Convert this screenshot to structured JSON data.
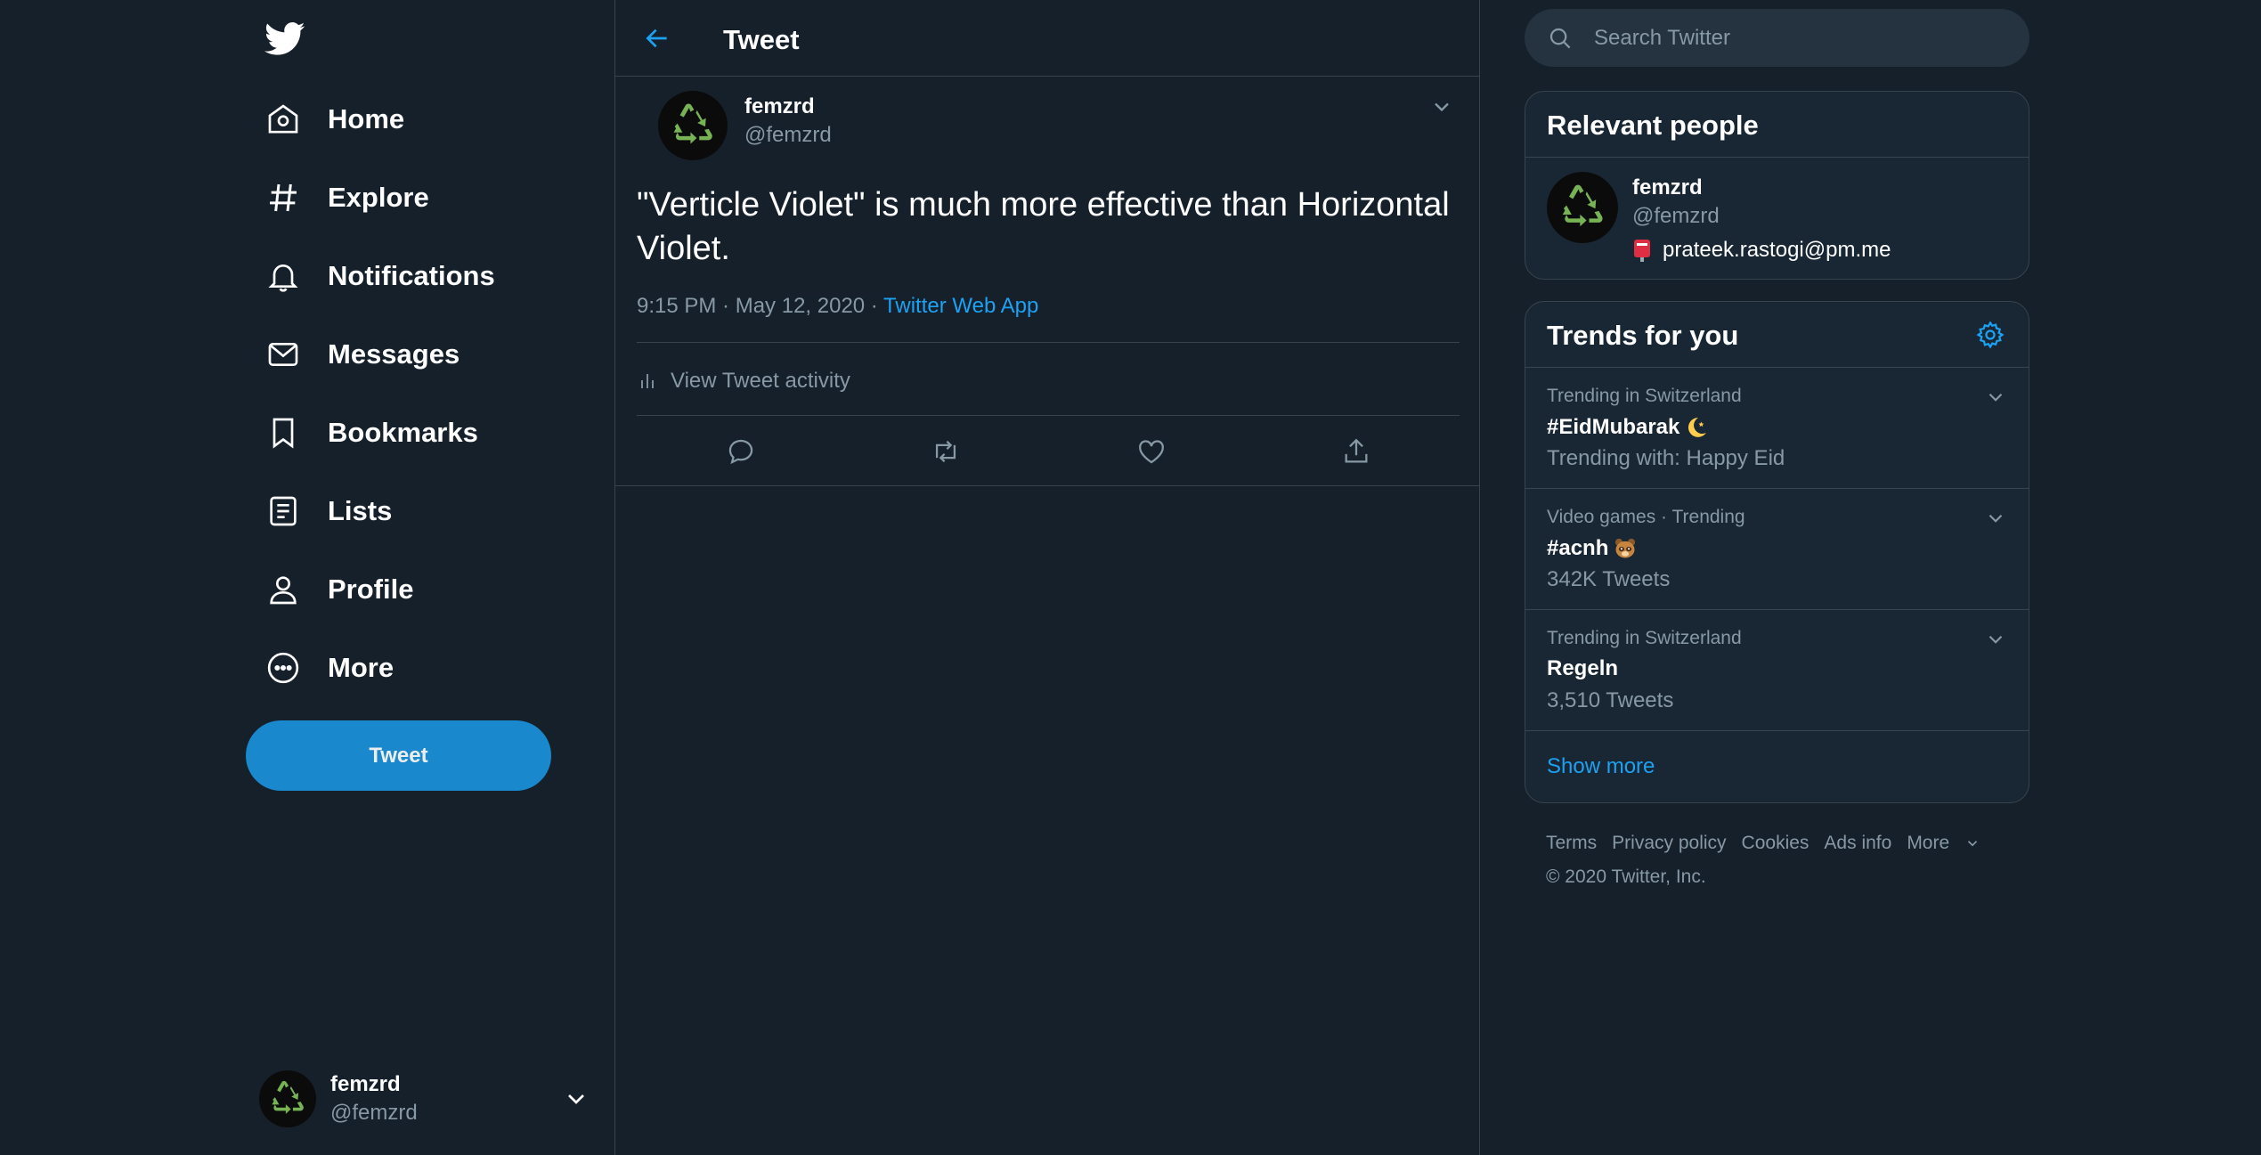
{
  "sidebar": {
    "logo": "twitter-bird-icon",
    "nav": [
      {
        "label": "Home",
        "icon": "home-icon"
      },
      {
        "label": "Explore",
        "icon": "hashtag-icon"
      },
      {
        "label": "Notifications",
        "icon": "bell-icon"
      },
      {
        "label": "Messages",
        "icon": "envelope-icon"
      },
      {
        "label": "Bookmarks",
        "icon": "bookmark-icon"
      },
      {
        "label": "Lists",
        "icon": "list-icon"
      },
      {
        "label": "Profile",
        "icon": "person-icon"
      },
      {
        "label": "More",
        "icon": "more-circle-icon"
      }
    ],
    "tweet_button": "Tweet",
    "account": {
      "name": "femzrd",
      "handle": "@femzrd"
    }
  },
  "main": {
    "header_title": "Tweet",
    "tweet": {
      "author_name": "femzrd",
      "author_handle": "@femzrd",
      "text": "\"Verticle Violet\" is much more effective than Horizontal Violet.",
      "time": "9:15 PM · May 12, 2020 · ",
      "source": "Twitter Web App",
      "activity_label": "View Tweet activity"
    }
  },
  "right": {
    "search_placeholder": "Search Twitter",
    "relevant": {
      "title": "Relevant people",
      "person": {
        "name": "femzrd",
        "handle": "@femzrd",
        "bio": "prateek.rastogi@pm.me"
      }
    },
    "trends": {
      "title": "Trends for you",
      "items": [
        {
          "context": "Trending in Switzerland",
          "name": "#EidMubarak",
          "sub": "Trending with: Happy Eid",
          "emoji": "crescent-moon-icon"
        },
        {
          "context": "Video games · Trending",
          "name": "#acnh",
          "sub": "342K Tweets",
          "emoji": "tanuki-icon"
        },
        {
          "context": "Trending in Switzerland",
          "name": "Regeln",
          "sub": "3,510 Tweets"
        }
      ],
      "show_more": "Show more"
    },
    "footer": {
      "links": [
        "Terms",
        "Privacy policy",
        "Cookies",
        "Ads info",
        "More"
      ],
      "copyright": "© 2020 Twitter, Inc."
    }
  },
  "colors": {
    "background": "#15202b",
    "panel": "#192734",
    "border": "#38444d",
    "accent": "#1da1f2",
    "button": "#1a91da",
    "muted": "#8899a6",
    "avatar_green": "#77b255"
  }
}
